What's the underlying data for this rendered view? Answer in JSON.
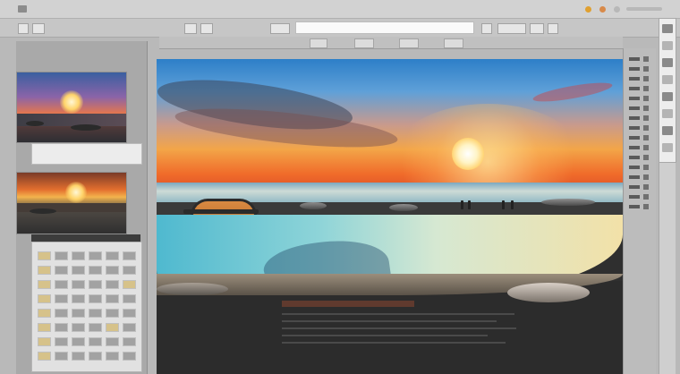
{
  "toolbar": {
    "tabs": [
      "",
      "",
      "",
      ""
    ],
    "right_labels": [
      "",
      "",
      ""
    ]
  },
  "left_panel": {
    "thumb_caption": "",
    "thumb2_label": "",
    "grid_rows": 8,
    "grid_cols": 6
  },
  "canvas": {
    "caption_title": ""
  },
  "colors": {
    "sky_top": "#2d7fc8",
    "sun_orange": "#f3a548",
    "lagoon_cyan": "#4fb9cf",
    "panel_gray": "#b9b9b9"
  },
  "icons": {
    "tool_strip": [
      "brush-icon",
      "layers-icon",
      "adjust-icon",
      "crop-icon",
      "text-icon",
      "zoom-icon",
      "history-icon",
      "color-icon"
    ]
  }
}
